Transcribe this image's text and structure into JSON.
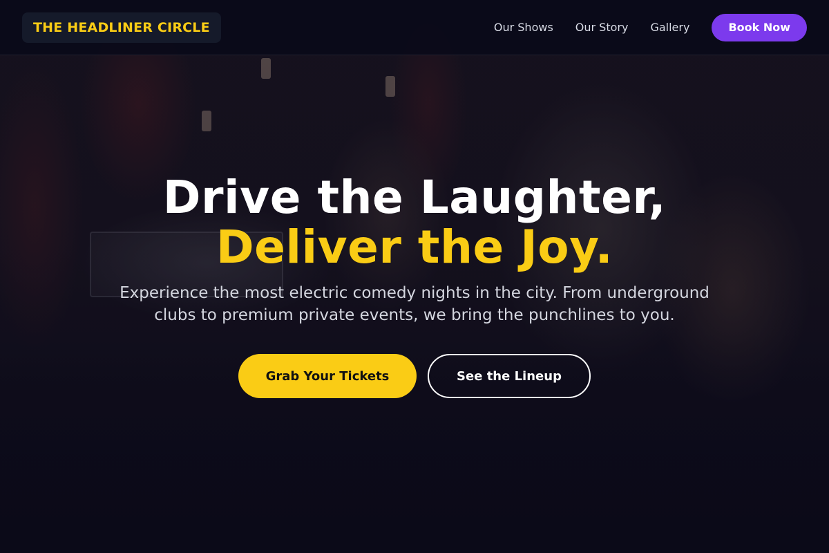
{
  "nav": {
    "logo": "THE HEADLINER CIRCLE",
    "links": [
      "Our Shows",
      "Our Story",
      "Gallery"
    ],
    "cta": "Book Now"
  },
  "hero": {
    "headline_line1": "Drive the Laughter,",
    "headline_line2": "Deliver the Joy.",
    "subtext": "Experience the most electric comedy nights in the city. From underground clubs to premium private events, we bring the punchlines to you.",
    "primary_cta": "Grab Your Tickets",
    "secondary_cta": "See the Lineup"
  },
  "colors": {
    "accent": "#facc15",
    "brand_purple": "#7c3aed",
    "background": "#0d0b1a"
  }
}
